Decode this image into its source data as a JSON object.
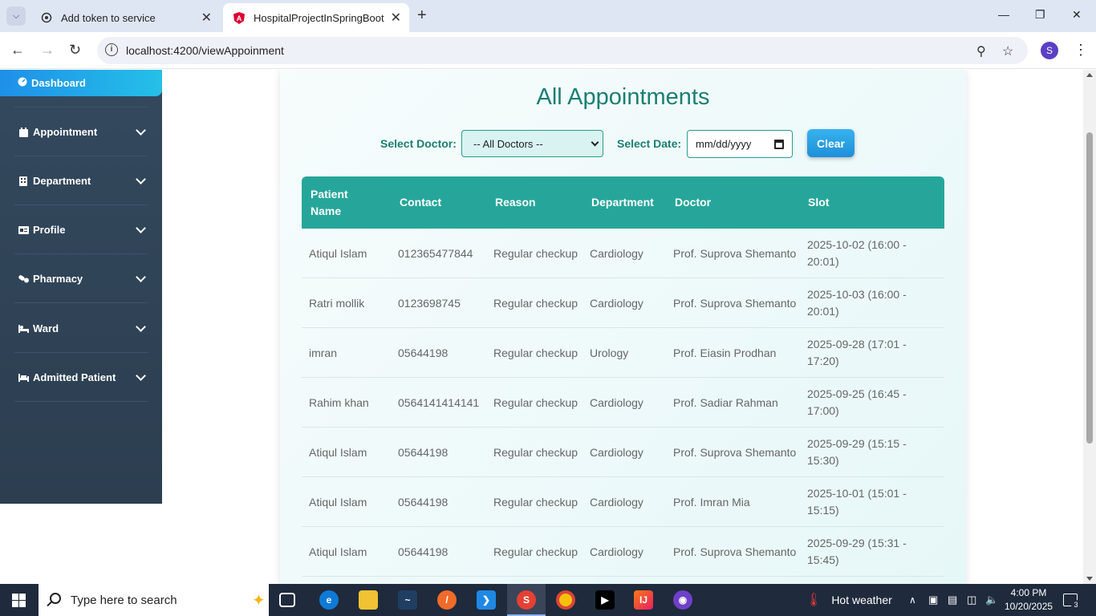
{
  "browser": {
    "tabs": [
      {
        "title": "Add token to service",
        "active": false
      },
      {
        "title": "HospitalProjectInSpringBoot",
        "active": true
      }
    ],
    "url": "localhost:4200/viewAppoinment",
    "profile_initial": "S"
  },
  "sidebar": {
    "active": {
      "label": "Dashboard",
      "icon": "gauge-icon"
    },
    "items": [
      {
        "label": "Appointment",
        "icon": "calendar-icon"
      },
      {
        "label": "Department",
        "icon": "building-icon"
      },
      {
        "label": "Profile",
        "icon": "id-card-icon"
      },
      {
        "label": "Pharmacy",
        "icon": "pills-icon"
      },
      {
        "label": "Ward",
        "icon": "bed-icon"
      },
      {
        "label": "Admitted Patient",
        "icon": "hospital-bed-icon"
      }
    ]
  },
  "main": {
    "title": "All Appointments",
    "filter": {
      "doctor_label": "Select Doctor:",
      "doctor_value": "-- All Doctors --",
      "date_label": "Select Date:",
      "date_placeholder": "mm/dd/yyyy",
      "clear_label": "Clear"
    },
    "table": {
      "headers": [
        "Patient Name",
        "Contact",
        "Reason",
        "Department",
        "Doctor",
        "Slot"
      ],
      "rows": [
        [
          "Atiqul Islam",
          "012365477844",
          "Regular checkup",
          "Cardiology",
          "Prof. Suprova Shemanto",
          "2025-10-02 (16:00 - 20:01)"
        ],
        [
          "Ratri mollik",
          "0123698745",
          "Regular checkup",
          "Cardiology",
          "Prof. Suprova Shemanto",
          "2025-10-03 (16:00 - 20:01)"
        ],
        [
          "imran",
          "05644198",
          "Regular checkup",
          "Urology",
          "Prof. Eiasin Prodhan",
          "2025-09-28 (17:01 - 17:20)"
        ],
        [
          "Rahim khan",
          "0564141414141",
          "Regular checkup",
          "Cardiology",
          "Prof. Sadiar Rahman",
          "2025-09-25 (16:45 - 17:00)"
        ],
        [
          "Atiqul Islam",
          "05644198",
          "Regular checkup",
          "Cardiology",
          "Prof. Suprova Shemanto",
          "2025-09-29 (15:15 - 15:30)"
        ],
        [
          "Atiqul Islam",
          "05644198",
          "Regular checkup",
          "Cardiology",
          "Prof. Imran Mia",
          "2025-10-01 (15:01 - 15:15)"
        ],
        [
          "Atiqul Islam",
          "05644198",
          "Regular checkup",
          "Cardiology",
          "Prof. Suprova Shemanto",
          "2025-09-29 (15:31 - 15:45)"
        ]
      ]
    }
  },
  "taskbar": {
    "search_placeholder": "Type here to search",
    "weather": "Hot weather",
    "time": "4:00 PM",
    "date": "10/20/2025",
    "notification_count": "3"
  },
  "colors": {
    "accent": "#26a69a",
    "title": "#1a7f74",
    "sidebar": "#2c3e50",
    "active_nav": "#1e90e8"
  }
}
